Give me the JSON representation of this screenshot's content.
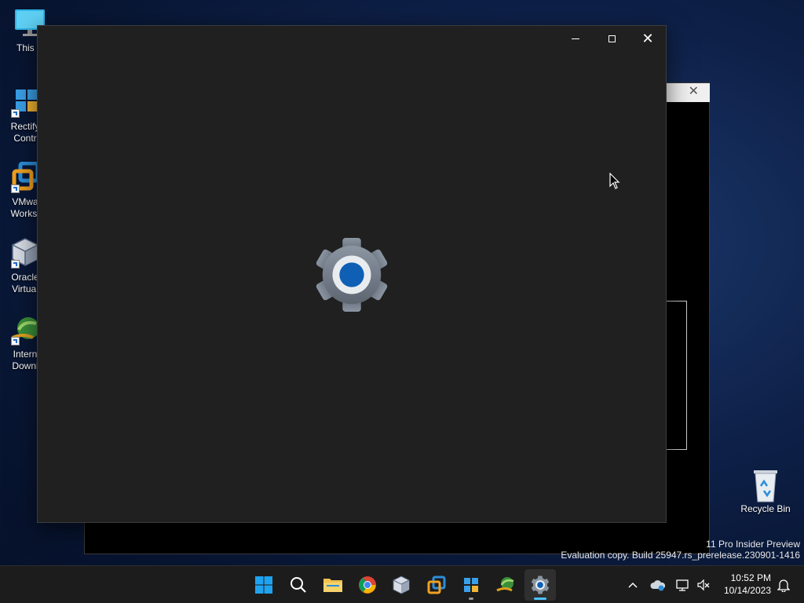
{
  "desktop": {
    "icons": [
      {
        "label_line1": "This P",
        "label_line2": ""
      },
      {
        "label_line1": "Rectify",
        "label_line2": "Contr"
      },
      {
        "label_line1": "VMwa",
        "label_line2": "Workst"
      },
      {
        "label_line1": "Oracle",
        "label_line2": "Virtual"
      },
      {
        "label_line1": "Intern",
        "label_line2": "Downl"
      }
    ],
    "recycle_bin_label": "Recycle Bin"
  },
  "main_window": {
    "minimize_icon": "minimize-icon",
    "maximize_icon": "maximize-icon",
    "close_icon": "close-icon",
    "splash_icon": "settings-gear-icon"
  },
  "watermark": {
    "line1": "11 Pro Insider Preview",
    "line2": "Evaluation copy. Build 25947.rs_prerelease.230901-1416"
  },
  "taskbar": {
    "apps": [
      "start",
      "search",
      "file-explorer",
      "chrome",
      "virtualbox",
      "vmware",
      "rectify11-control-center",
      "internet-download-manager",
      "settings"
    ],
    "clock": {
      "time": "10:52 PM",
      "date": "10/14/2023"
    }
  },
  "colors": {
    "window_bg": "#202020",
    "accent": "#4cc2ff",
    "gear_blue": "#0f5fb5",
    "taskbar_bg": "#1c1c1c"
  }
}
